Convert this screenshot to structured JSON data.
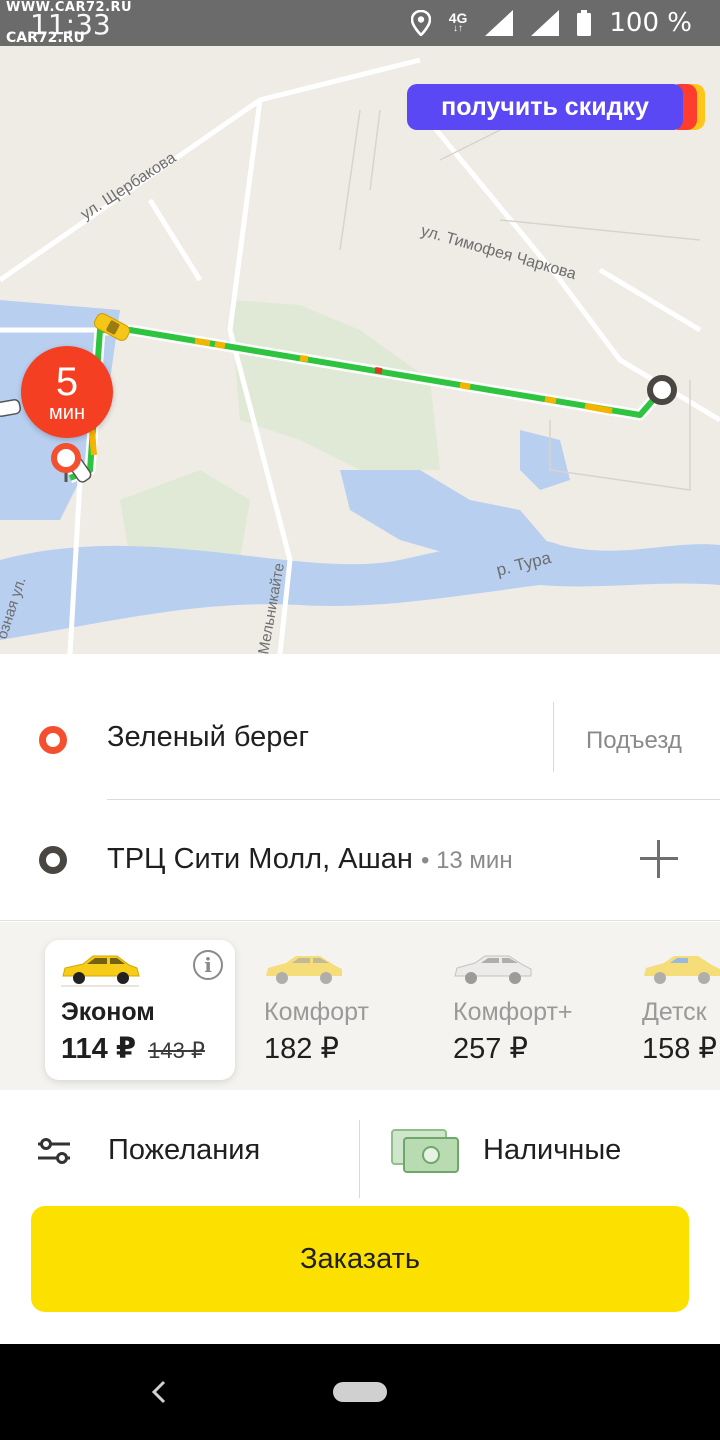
{
  "status_bar": {
    "watermark_top": "WWW.CAR72.RU",
    "time": "11:33",
    "watermark_bottom": "CAR72.RU",
    "network": "4G",
    "battery": "100 %",
    "icons": [
      "location-icon",
      "signal-icon",
      "signal-icon",
      "battery-icon"
    ]
  },
  "map": {
    "promo_label": "получить скидку",
    "eta_value": "5",
    "eta_unit": "мин",
    "street_labels": [
      "ул. Щербакова",
      "ул. Тимофея Чаркова",
      "р. Тура",
      "Мельникайте",
      "озная ул."
    ]
  },
  "route": {
    "from_address": "Зеленый берег",
    "entrance_label": "Подъезд",
    "to_address": "ТРЦ Сити Молл, Ашан",
    "to_eta": "• 13 мин"
  },
  "tariffs": [
    {
      "name": "Эконом",
      "price": "114 ₽",
      "old_price": "143 ₽",
      "selected": true
    },
    {
      "name": "Комфорт",
      "price": "182 ₽",
      "selected": false
    },
    {
      "name": "Комфорт+",
      "price": "257 ₽",
      "selected": false
    },
    {
      "name": "Детск",
      "price": "158 ₽",
      "selected": false
    }
  ],
  "options": {
    "wishes_label": "Пожелания",
    "payment_label": "Наличные"
  },
  "order_button": "Заказать",
  "colors": {
    "accent_yellow": "#fce000",
    "promo_purple": "#5a48f5",
    "route_green": "#2fc43f",
    "pin_red": "#f4502f"
  }
}
